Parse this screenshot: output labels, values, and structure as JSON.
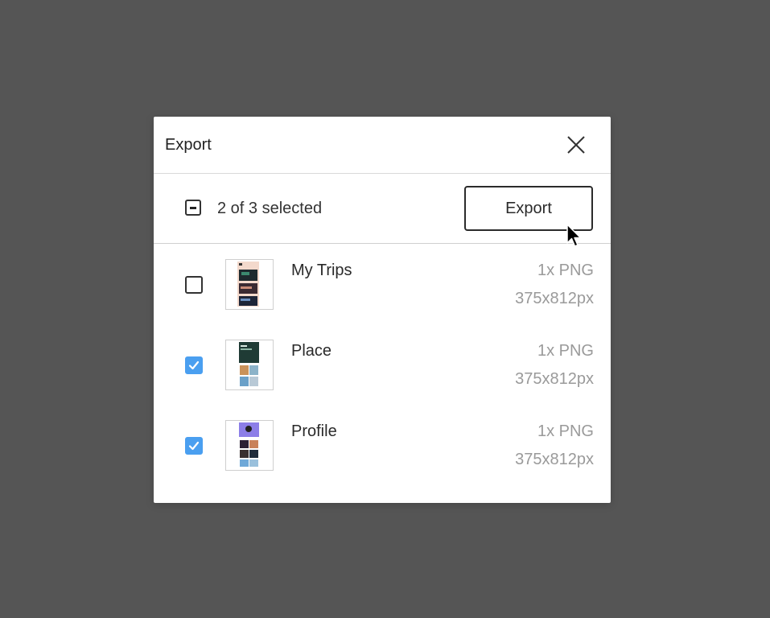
{
  "dialog": {
    "title": "Export",
    "close_icon": "close-icon"
  },
  "toolbar": {
    "selection_state": "mixed",
    "selection_count": "2 of 3 selected",
    "export_label": "Export"
  },
  "frames": [
    {
      "name": "My Trips",
      "checked": false,
      "scale_format": "1x PNG",
      "dimensions": "375x812px"
    },
    {
      "name": "Place",
      "checked": true,
      "scale_format": "1x PNG",
      "dimensions": "375x812px"
    },
    {
      "name": "Profile",
      "checked": true,
      "scale_format": "1x PNG",
      "dimensions": "375x812px"
    }
  ],
  "colors": {
    "backdrop": "#555555",
    "checkbox_checked": "#4a9ff0",
    "secondary_text": "#9a9a9a"
  }
}
